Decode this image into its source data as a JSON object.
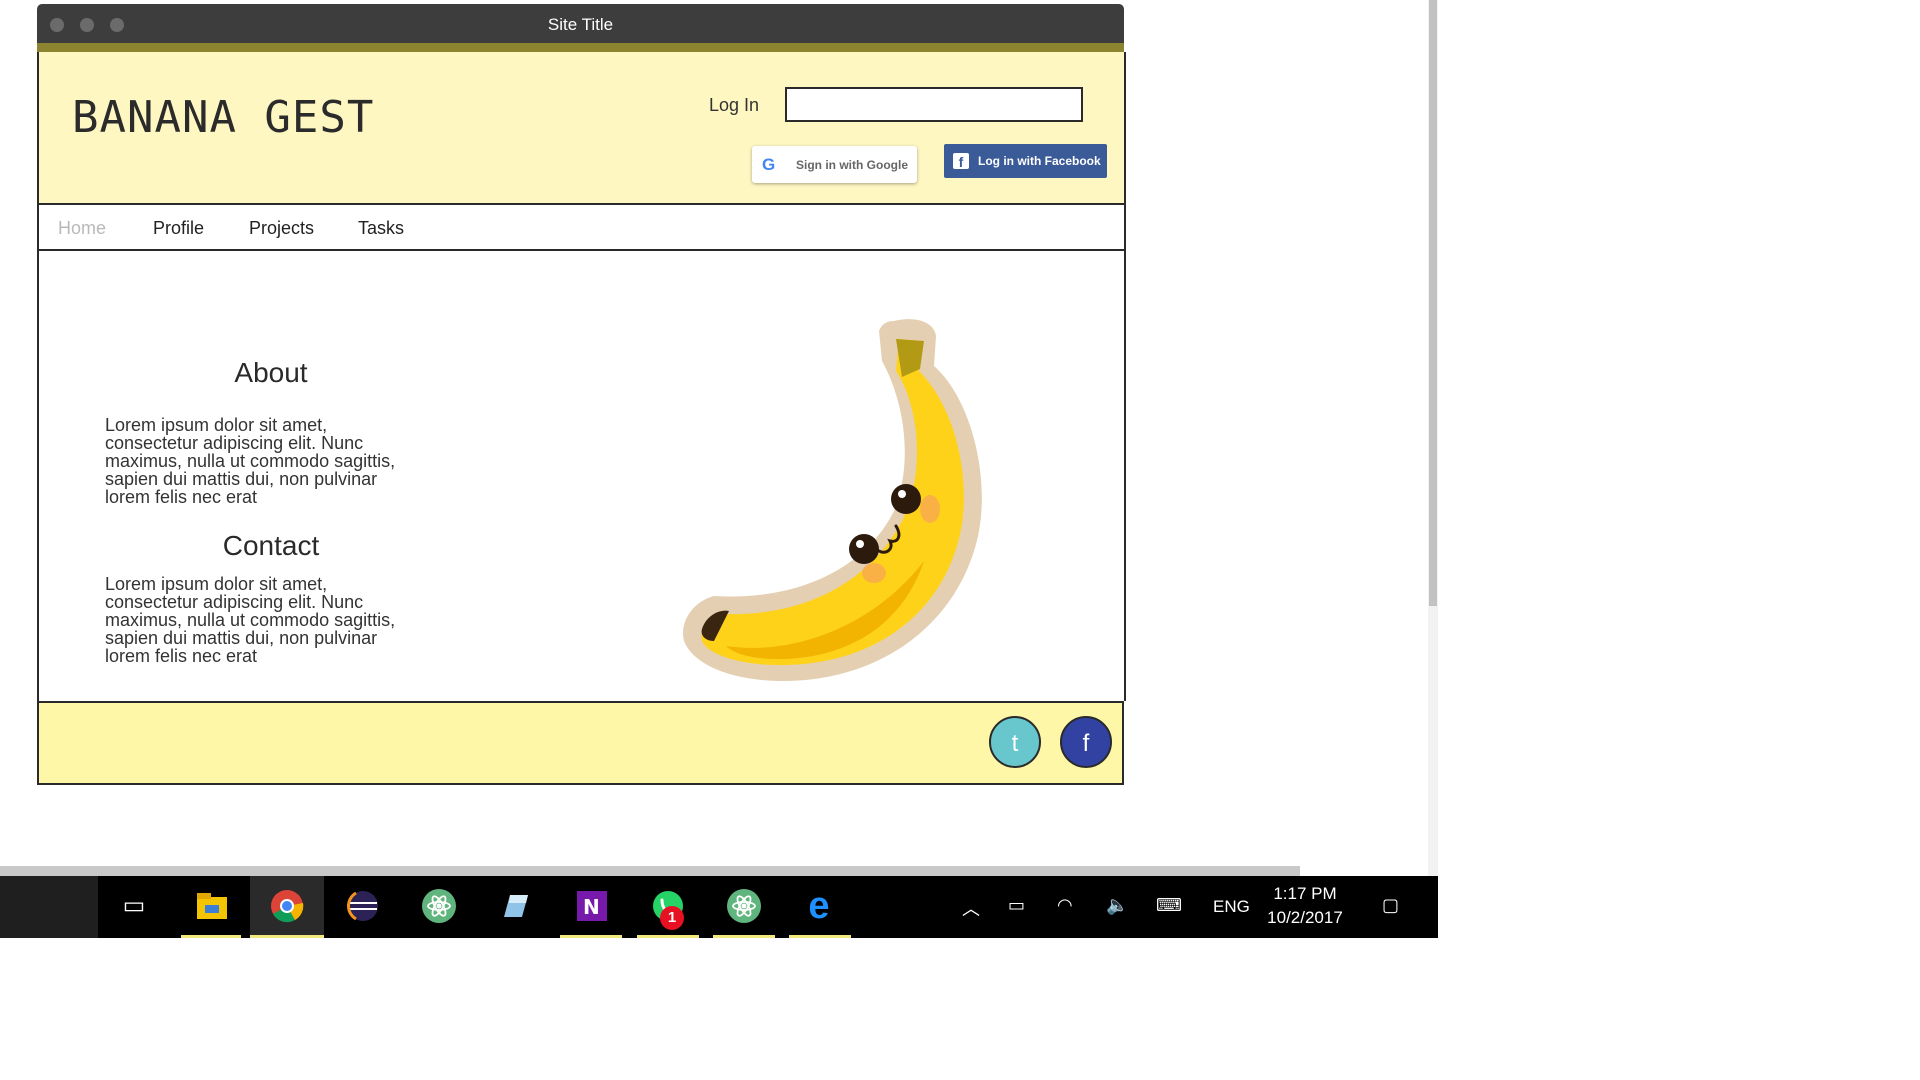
{
  "window": {
    "title": "Site Title"
  },
  "header": {
    "brand": "BANANA GEST",
    "login_label": "Log In",
    "login_value": "",
    "google_label": "Sign in with Google",
    "facebook_label": "Log in with Facebook"
  },
  "nav": {
    "items": [
      "Home",
      "Profile",
      "Projects",
      "Tasks"
    ],
    "active": "Home"
  },
  "main": {
    "about": {
      "title": "About",
      "body": "Lorem ipsum dolor sit amet, consectetur adipiscing elit. Nunc maximus, nulla ut commodo sagittis, sapien dui mattis dui, non pulvinar lorem felis nec erat"
    },
    "contact": {
      "title": "Contact",
      "body": "Lorem ipsum dolor sit amet, consectetur adipiscing elit. Nunc maximus, nulla ut commodo sagittis, sapien dui mattis dui, non pulvinar lorem felis nec erat"
    }
  },
  "footer": {
    "twitter_letter": "t",
    "facebook_letter": "f"
  },
  "colors": {
    "header_bg": "#fff7c2",
    "footer_bg": "#fff7a8",
    "facebook_blue": "#3b5a98",
    "twitter_teal": "#67c7cc"
  },
  "taskbar": {
    "icons": [
      "task-view-icon",
      "file-explorer-icon",
      "chrome-icon",
      "eclipse-icon",
      "atom-icon",
      "app-icon",
      "onenote-icon",
      "whatsapp-icon",
      "atom-icon",
      "edge-icon"
    ],
    "whatsapp_badge": "1",
    "language": "ENG",
    "time": "1:17 PM",
    "date": "10/2/2017"
  }
}
